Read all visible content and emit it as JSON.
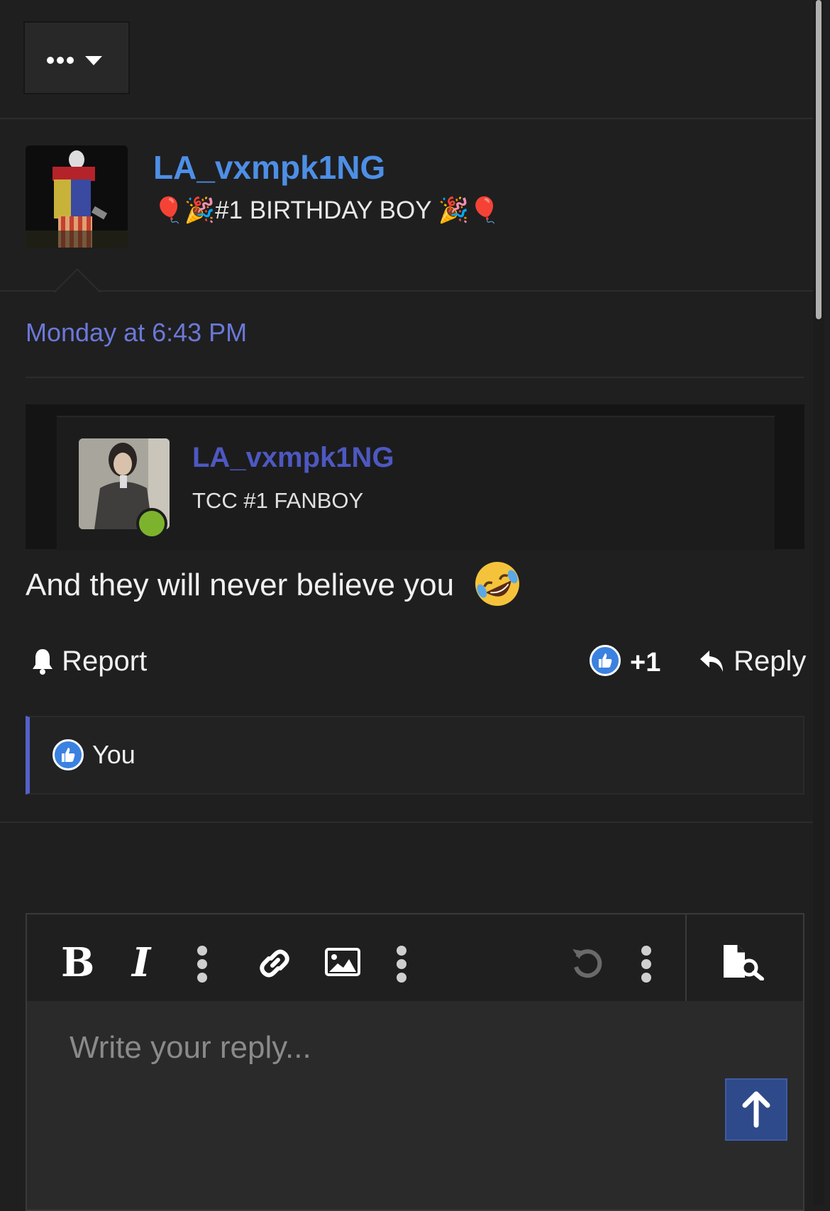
{
  "thread_menu": {
    "icon": "more-dots-icon",
    "caret": "chevron-down-icon"
  },
  "post": {
    "author": {
      "name": "LA_vxmpk1NG",
      "title": "🎈🎉#1 BIRTHDAY BOY 🎉🎈"
    },
    "date": "Monday at 6:43 PM",
    "quote": {
      "author": "LA_vxmpk1NG",
      "author_title": "TCC #1 FANBOY",
      "online": true
    },
    "body_text": "And they will never believe you",
    "body_emoji": "🤣",
    "actions": {
      "report_label": "Report",
      "like_count": "+1",
      "reply_label": "Reply"
    },
    "reactions": {
      "label": "You"
    }
  },
  "editor": {
    "bold_label": "B",
    "italic_label": "I",
    "placeholder": "Write your reply..."
  },
  "colors": {
    "background": "#1f1f20",
    "username": "#4d8fe6",
    "date": "#6b79d8",
    "like": "#3b82e0",
    "accent_bar": "#5561c9",
    "online": "#7db32c"
  }
}
